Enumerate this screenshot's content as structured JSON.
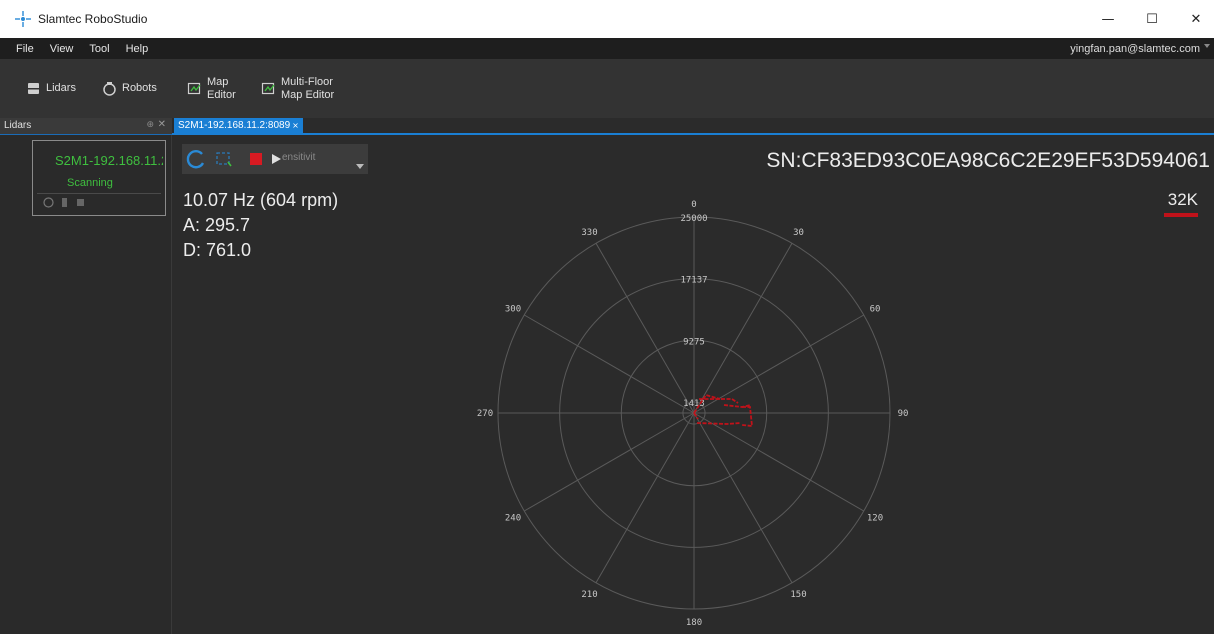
{
  "window": {
    "title": "Slamtec RoboStudio",
    "minimize": "—",
    "maximize": "☐",
    "close": "✕"
  },
  "menu": {
    "items": [
      "File",
      "View",
      "Tool",
      "Help"
    ],
    "user": "yingfan.pan@slamtec.com"
  },
  "toolbar": {
    "lidars": "Lidars",
    "robots": "Robots",
    "map_editor_1": "Map",
    "map_editor_2": "Editor",
    "multifloor_1": "Multi-Floor",
    "multifloor_2": "Map Editor"
  },
  "panel": {
    "title": "Lidars",
    "pin": "⊕",
    "close": "✕"
  },
  "device": {
    "name": "S2M1-192.168.11.2:8089",
    "status": "Scanning"
  },
  "tab": {
    "label": "S2M1-192.168.11.2:8089",
    "close": "×"
  },
  "controls": {
    "sensitivity": "ensitivit"
  },
  "stats": {
    "frequency": "10.07 Hz (604 rpm)",
    "angle": "A: 295.7",
    "distance": "D: 761.0"
  },
  "sn": "SN:CF83ED93C0EA98C6C2E29EF53D594061",
  "sample_rate": "32K",
  "colors": {
    "accent": "#1a7fd4",
    "scan": "#c0121a",
    "status": "#3fbf3f"
  },
  "chart_data": {
    "type": "polar",
    "radial_ticks": [
      "1413",
      "9275",
      "17137",
      "25000"
    ],
    "angle_ticks": [
      "0",
      "30",
      "60",
      "90",
      "120",
      "150",
      "180",
      "210",
      "240",
      "270",
      "300",
      "330"
    ],
    "rmax": 25000,
    "grid": true
  }
}
